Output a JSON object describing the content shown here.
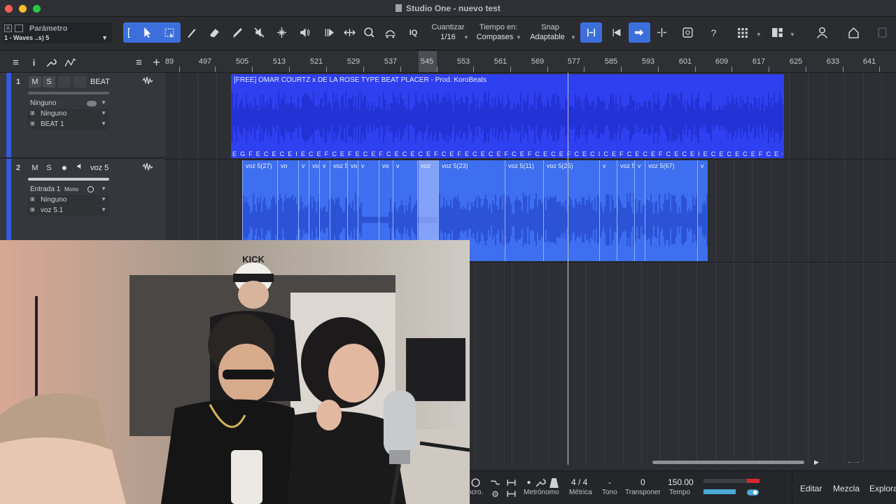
{
  "window": {
    "title": "Studio One - nuevo test"
  },
  "parameter": {
    "title": "Parámetro",
    "value": "1 - Waves ..s) 5"
  },
  "toolbar": {
    "quantize_label": "Cuantizar",
    "quantize_value": "1/16",
    "timebase_label": "Tiempo en:",
    "timebase_value": "Compases",
    "snap_label": "Snap",
    "snap_value": "Adaptable",
    "iq_label": "IQ",
    "help_label": "?"
  },
  "ruler": {
    "marks": [
      "89",
      "497",
      "505",
      "513",
      "521",
      "529",
      "537",
      "545",
      "553",
      "561",
      "569",
      "577",
      "585",
      "593",
      "601",
      "609",
      "617",
      "625",
      "633",
      "641"
    ]
  },
  "tracks": [
    {
      "number": "1",
      "mute": "M",
      "solo": "S",
      "name": "BEAT",
      "field1": "Ninguno",
      "field2": "Ninguno",
      "field3": "BEAT 1"
    },
    {
      "number": "2",
      "mute": "M",
      "solo": "S",
      "name": "voz 5",
      "field1": "Entrada 1",
      "field1_mode": "Mono",
      "field2": "Ninguno",
      "field3": "voz 5.1"
    }
  ],
  "beat_clip": {
    "title": "[FREE] OMAR COURTZ x DE LA ROSE  TYPE BEAT  PLACER  - Prod. KoroBeats",
    "chords": "E G F E C E C E I E C E F C E F E C E F C E C E C E F C E F E C E C E F C E F C E C E F C E C I C E F C E C E F C E C E I E C E C E C E F C E C E F C E C E F E C E F C E C E F C E F C E C E F C E F C E C E F C E C E F"
  },
  "voz_clips": [
    {
      "label": "voz 5(27)"
    },
    {
      "label": "vo"
    },
    {
      "label": "v"
    },
    {
      "label": "vo"
    },
    {
      "label": "v"
    },
    {
      "label": "voz 5"
    },
    {
      "label": "vo"
    },
    {
      "label": "v"
    },
    {
      "label": "vo"
    },
    {
      "label": "v"
    },
    {
      "label": "voz"
    },
    {
      "label": "voz 5(23)"
    },
    {
      "label": "voz 5(11)"
    },
    {
      "label": "voz 5(25)"
    },
    {
      "label": "v"
    },
    {
      "label": "voz 5"
    },
    {
      "label": "v"
    },
    {
      "label": "voz 5(67)"
    },
    {
      "label": "v"
    }
  ],
  "transport": {
    "metronome_label": "Metrónomo",
    "meter_value": "4 / 4",
    "meter_label": "Métrica",
    "key_value": "-",
    "key_label": "Tono",
    "transpose_value": "0",
    "transpose_label": "Transponer",
    "tempo_value": "150.00",
    "tempo_label": "Tempo",
    "sync_label": "ncro.",
    "tab_edit": "Editar",
    "tab_mix": "Mezcla",
    "tab_browse": "Explora"
  },
  "webcam": {
    "cap_text": "KICK"
  },
  "colors": {
    "accent": "#3d6fdc",
    "beat_clip": "#2f40f0",
    "voz_clip": "#3e6ff0",
    "meter_peak": "#e0252e"
  }
}
